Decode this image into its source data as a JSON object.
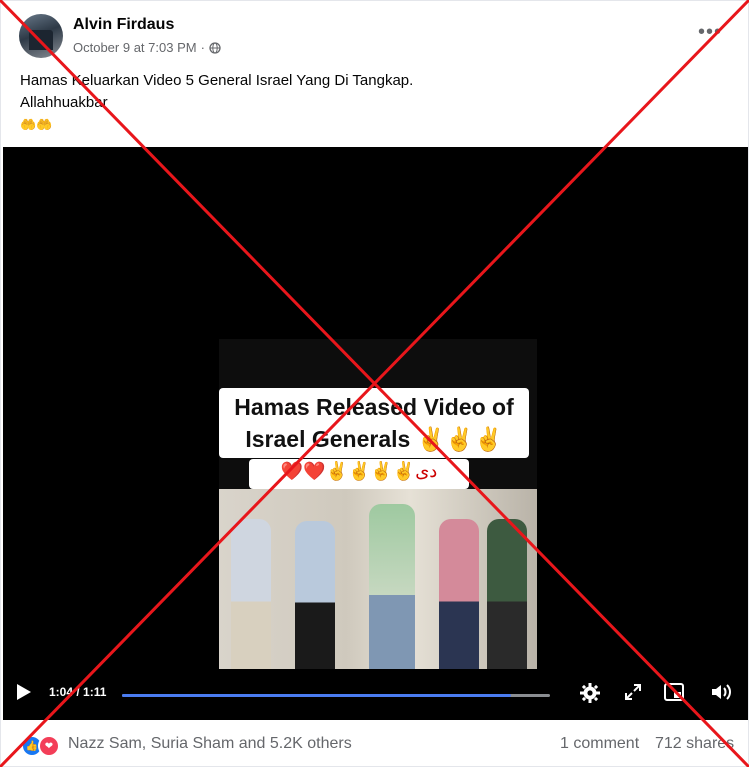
{
  "post": {
    "author": "Alvin Firdaus",
    "timestamp": "October 9 at 7:03 PM",
    "separator": "·",
    "audience_icon": "globe-icon",
    "more_icon": "more-horizontal-icon",
    "caption_line1": "Hamas Keluarkan Video 5 General Israel Yang Di Tangkap.",
    "caption_line2": "Allahhuakbar",
    "caption_emoji": "🤲🤲"
  },
  "video": {
    "overlay_line1": "Hamas Released Video of",
    "overlay_line2": "Israel Generals ✌️✌️✌️",
    "overlay_line3": "❤️❤️✌️✌️✌️✌️دی",
    "current_time": "1:04",
    "duration": "1:11",
    "time_separator": " / ",
    "progress_fraction": 0.91,
    "accent_color": "#4a7cf0"
  },
  "footer": {
    "reaction_names": "Nazz Sam, Suria Sham and 5.2K others",
    "comments": "1 comment",
    "shares": "712 shares",
    "like_color": "#1877f2",
    "love_color": "#f33e58"
  },
  "overlay_mark": {
    "color": "#e8161b"
  }
}
